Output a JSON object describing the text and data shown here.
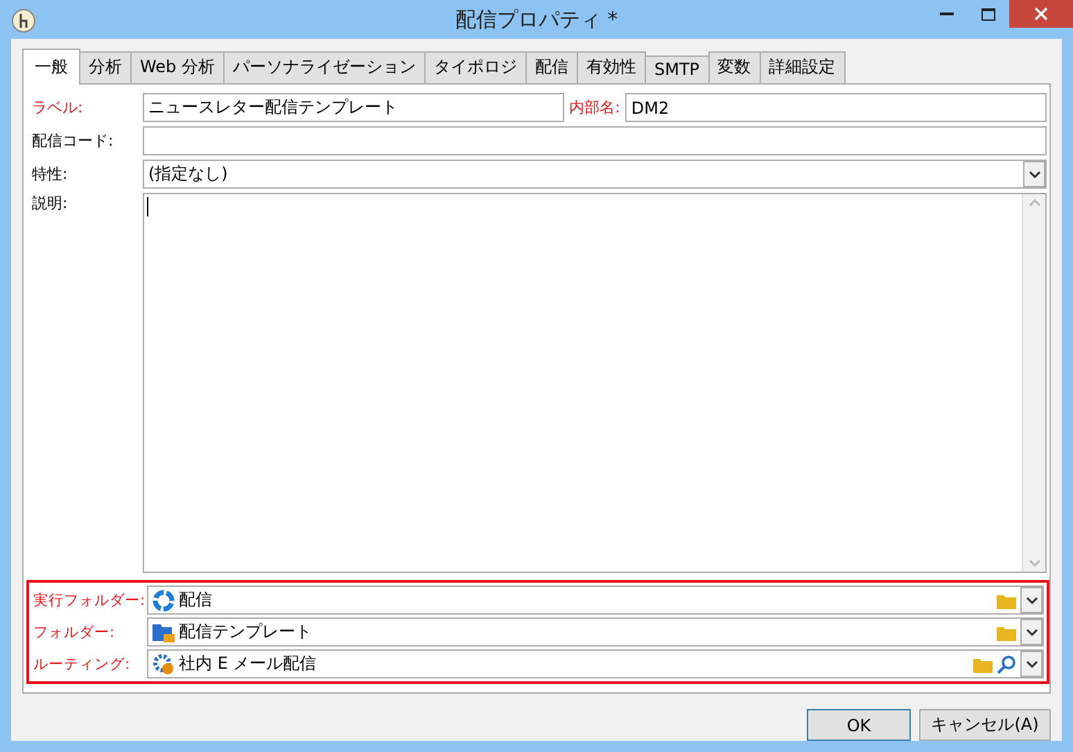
{
  "window": {
    "title": "配信プロパティ *"
  },
  "tabs": [
    {
      "label": "一般",
      "selected": true
    },
    {
      "label": "分析",
      "selected": false
    },
    {
      "label": "Web 分析",
      "selected": false
    },
    {
      "label": "パーソナライゼーション",
      "selected": false
    },
    {
      "label": "タイポロジ",
      "selected": false
    },
    {
      "label": "配信",
      "selected": false
    },
    {
      "label": "有効性",
      "selected": false
    },
    {
      "label": "SMTP",
      "selected": false
    },
    {
      "label": "変数",
      "selected": false
    },
    {
      "label": "詳細設定",
      "selected": false
    }
  ],
  "label_row": {
    "label": {
      "label": "ラベル:",
      "required": true,
      "value": "ニュースレター配信テンプレート"
    },
    "internal_name": {
      "label": "内部名:",
      "required": true,
      "value": "DM2"
    }
  },
  "delivery_code": {
    "label": "配信コード:",
    "required": false
  },
  "nature": {
    "label": "特性:",
    "required": false,
    "value": "(指定なし)"
  },
  "description": {
    "label": "説明:",
    "required": false
  },
  "folders": [
    {
      "kind": "execution",
      "label": "実行フォルダー:",
      "required": true,
      "value": "配信",
      "searchable": false
    },
    {
      "kind": "folder",
      "label": "フォルダー:",
      "required": true,
      "value": "配信テンプレート",
      "searchable": false
    },
    {
      "kind": "routing",
      "label": "ルーティング:",
      "required": true,
      "value": "社内 E メール配信",
      "searchable": true
    }
  ],
  "buttons": [
    "OK",
    "キャンセル(A)"
  ]
}
